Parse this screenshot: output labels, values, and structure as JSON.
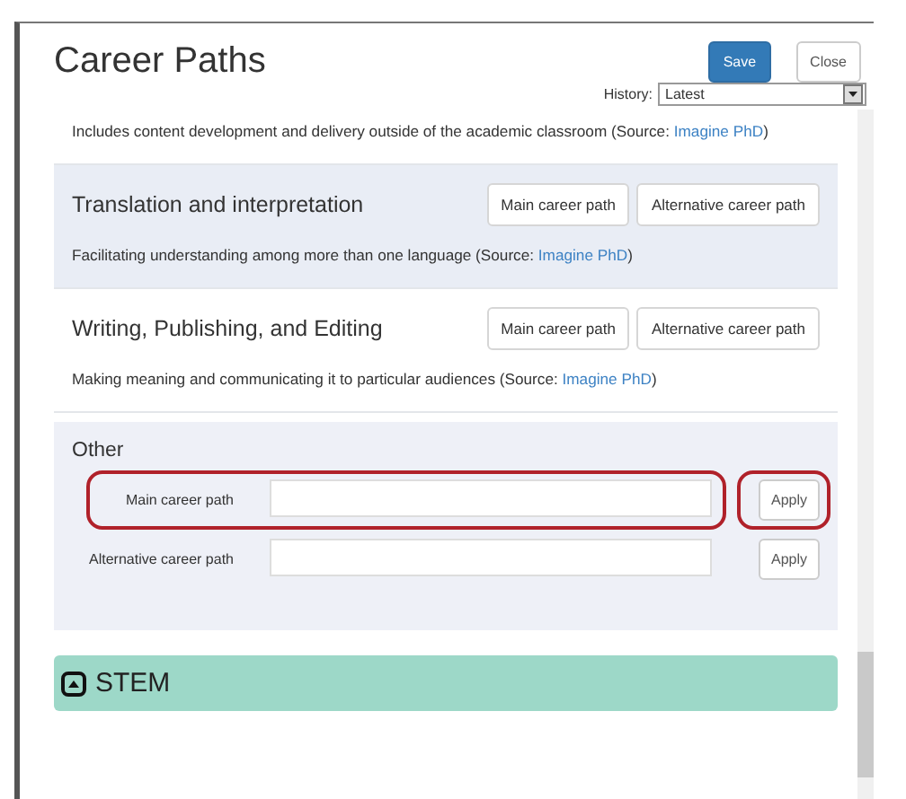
{
  "dialog": {
    "title": "Career Paths",
    "buttons": [
      {
        "label": "Save",
        "kind": "primary"
      },
      {
        "label": "Close",
        "kind": "default"
      }
    ],
    "history": {
      "label": "History:",
      "value": "Latest"
    }
  },
  "careers": [
    {
      "description": "Includes content development and delivery outside of the academic classroom (Source: ",
      "link": "Imagine PhD",
      "after": ")",
      "shaded": false
    },
    {
      "title": "Translation and interpretation",
      "description": "Facilitating understanding among more than one language (Source: ",
      "link": "Imagine PhD",
      "after": ")",
      "shaded": true,
      "buttons": [
        "Main career path",
        "Alternative career path"
      ]
    },
    {
      "title": "Writing, Publishing, and Editing",
      "description": "Making meaning and communicating it to particular audiences (Source: ",
      "link": "Imagine PhD",
      "after": ")",
      "shaded": false,
      "buttons": [
        "Main career path",
        "Alternative career path"
      ]
    }
  ],
  "other": {
    "title": "Other",
    "fields": [
      {
        "label": "Main career path",
        "highlighted": true,
        "apply": {
          "label": "Apply",
          "highlighted": true
        }
      },
      {
        "label": "Alternative career path",
        "highlighted": false,
        "apply": {
          "label": "Apply",
          "highlighted": false
        }
      }
    ]
  },
  "stem": {
    "title": "STEM",
    "expanded": false
  }
}
